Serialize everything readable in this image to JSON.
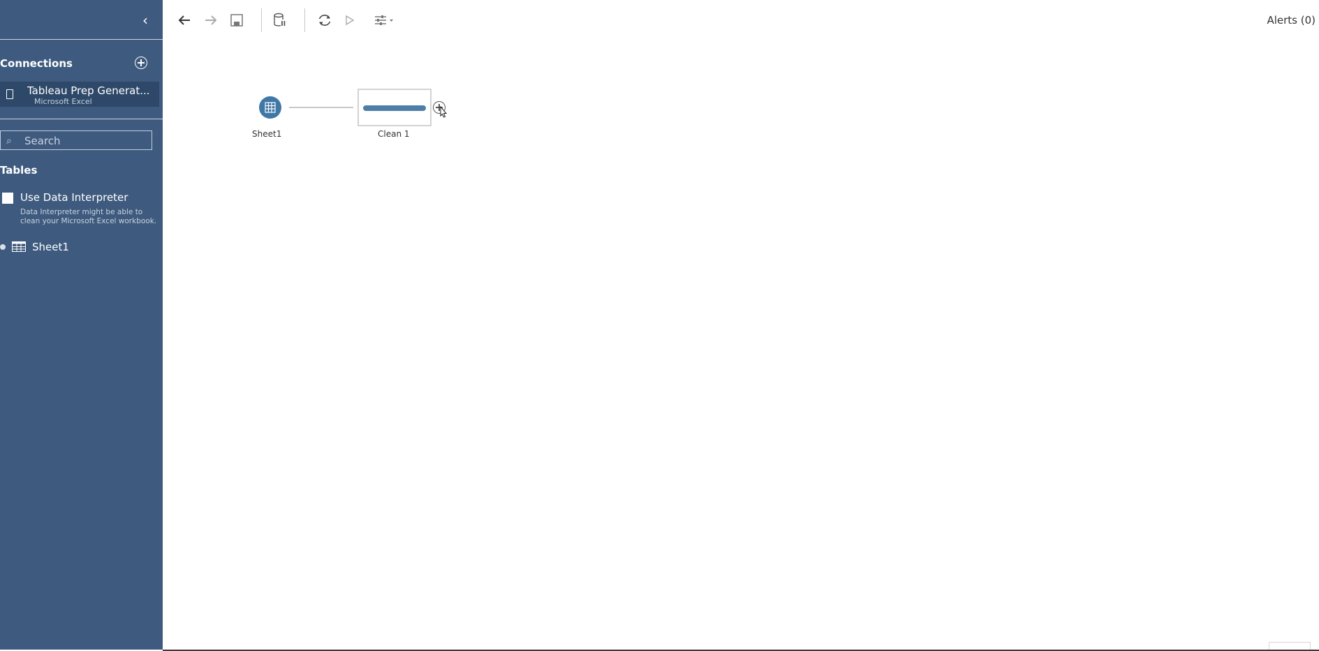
{
  "sidebar": {
    "connections_header": "Connections",
    "connection": {
      "name": "Tableau Prep Generat...",
      "type": "Microsoft Excel"
    },
    "search": {
      "placeholder": "Search"
    },
    "tables_header": "Tables",
    "data_interpreter": {
      "label": "Use Data Interpreter",
      "description": "Data Interpreter might be able to clean your Microsoft Excel workbook.",
      "checked": false
    },
    "tables": [
      {
        "label": "Sheet1"
      }
    ]
  },
  "toolbar": {
    "alerts_label": "Alerts (0)"
  },
  "flow": {
    "nodes": [
      {
        "label": "Sheet1",
        "kind": "input"
      },
      {
        "label": "Clean 1",
        "kind": "clean"
      }
    ]
  },
  "colors": {
    "sidebar_bg": "#3e5a7e",
    "selected_bg": "#2d4868",
    "node_accent": "#4e7ea8"
  }
}
